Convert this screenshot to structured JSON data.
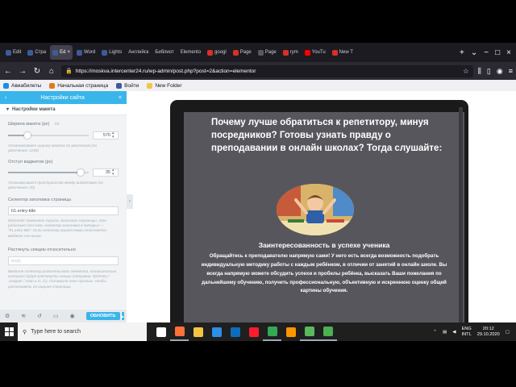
{
  "browser": {
    "tabs": [
      {
        "label": "Edit",
        "color": "#3c5b9a",
        "active": false
      },
      {
        "label": "Стра",
        "color": "#3c5b9a",
        "active": false
      },
      {
        "label": "Ed",
        "color": "#3c5b9a",
        "active": true
      },
      {
        "label": "Word",
        "color": "#3c5b9a",
        "active": false
      },
      {
        "label": "Lights",
        "color": "#3c5b9a",
        "active": false
      },
      {
        "label": "Английск",
        "color": "#5a5a5a",
        "active": false
      },
      {
        "label": "Библиот",
        "color": "#5a5a5a",
        "active": false
      },
      {
        "label": "Elemento",
        "color": "#5a5a5a",
        "active": false
      },
      {
        "label": "googl",
        "color": "#d93025",
        "active": false
      },
      {
        "label": "Page",
        "color": "#d93025",
        "active": false
      },
      {
        "label": "Page",
        "color": "#5a5a5a",
        "active": false
      },
      {
        "label": "rym",
        "color": "#d93025",
        "active": false
      },
      {
        "label": "YouTu",
        "color": "#ff0000",
        "active": false
      },
      {
        "label": "New T",
        "color": "#d93025",
        "active": false
      }
    ],
    "url": "https://moskva.intercenter24.ru/wp-admin/post.php?post=2&action=elementor",
    "bookmarks": [
      "Авиабилеты",
      "Начальная страница",
      "Войти",
      "New Folder"
    ]
  },
  "panel": {
    "title": "Настройки сайта",
    "section": "Настройки макета",
    "width_label": "Ширина макета (px)",
    "width_value": "570",
    "width_fraction": 0.24,
    "width_hint": "Установливает ширину макета по умолчанию (по умолчанию: 1140)",
    "widget_gap_label": "Отступ виджетов (px)",
    "widget_gap_value": "35",
    "widget_gap_fraction": 0.9,
    "widget_gap_hint": "Устанавливает пространство между виджетами (по умолчанию: 20)",
    "selector_label": "Селектор заголовка страницы",
    "selector_value": "h1.entry-title",
    "selector_hint": "Elementor позволяет скрыть заголовок страницы. Это работает для тем, селектор заголовка в которых — \"h1.entry-title\". Если селектор вашей темы отличается, введите его выше.",
    "stretch_label": "Растянуть секцию относительно",
    "stretch_placeholder": "body",
    "stretch_hint": "Введите селектор родительского элемента, относительно которого будут растянуты секции (например: #primary / .wrapper / main и т. д.). Оставьте поле пустым, чтобы растягивать по ширине страницы.",
    "update_label": "ОБНОВИТЬ",
    "accent": "#39b5ea"
  },
  "preview": {
    "heading": "Почему лучше обратиться к репетитору, минуя посредников? Готовы узнать правду о преподавании в онлайн школах? Тогда слушайте:",
    "subheading": "Заинтересованность в успехе ученика",
    "paragraph": "Обращайтесь к преподавателю напрямую сами! У него есть всегда возможность подобрать индивидуальную методику работы с каждым ребёнком, в отличии от занятий в онлайн школе. Вы всегда напрямую можете обсудить успехи и пробелы ребёнка, высказать Ваши пожелания по дальнейшему обучению, получить профессиональную, объективную и искреннюю оценку общей картины обучения."
  },
  "taskbar": {
    "search_placeholder": "Type here to search",
    "lang": "ENG",
    "lang_sub": "INTL",
    "time": "20:12",
    "date": "29.10.2020",
    "apps": [
      {
        "name": "task-view-icon",
        "color": "#ffffff",
        "open": false
      },
      {
        "name": "firefox-icon",
        "color": "#ff7139",
        "open": true
      },
      {
        "name": "explorer-icon",
        "color": "#f4c542",
        "open": false
      },
      {
        "name": "edge-icon",
        "color": "#2f8ee5",
        "open": false
      },
      {
        "name": "store-icon",
        "color": "#0f6cbd",
        "open": false
      },
      {
        "name": "opera-icon",
        "color": "#ff1b2d",
        "open": false
      },
      {
        "name": "chrome-icon",
        "color": "#34a853",
        "open": true
      },
      {
        "name": "firefox-alt-icon",
        "color": "#ff9500",
        "open": false
      },
      {
        "name": "camtasia-icon",
        "color": "#5cb85c",
        "open": true
      },
      {
        "name": "recorder-icon",
        "color": "#4caf50",
        "open": true
      }
    ]
  }
}
